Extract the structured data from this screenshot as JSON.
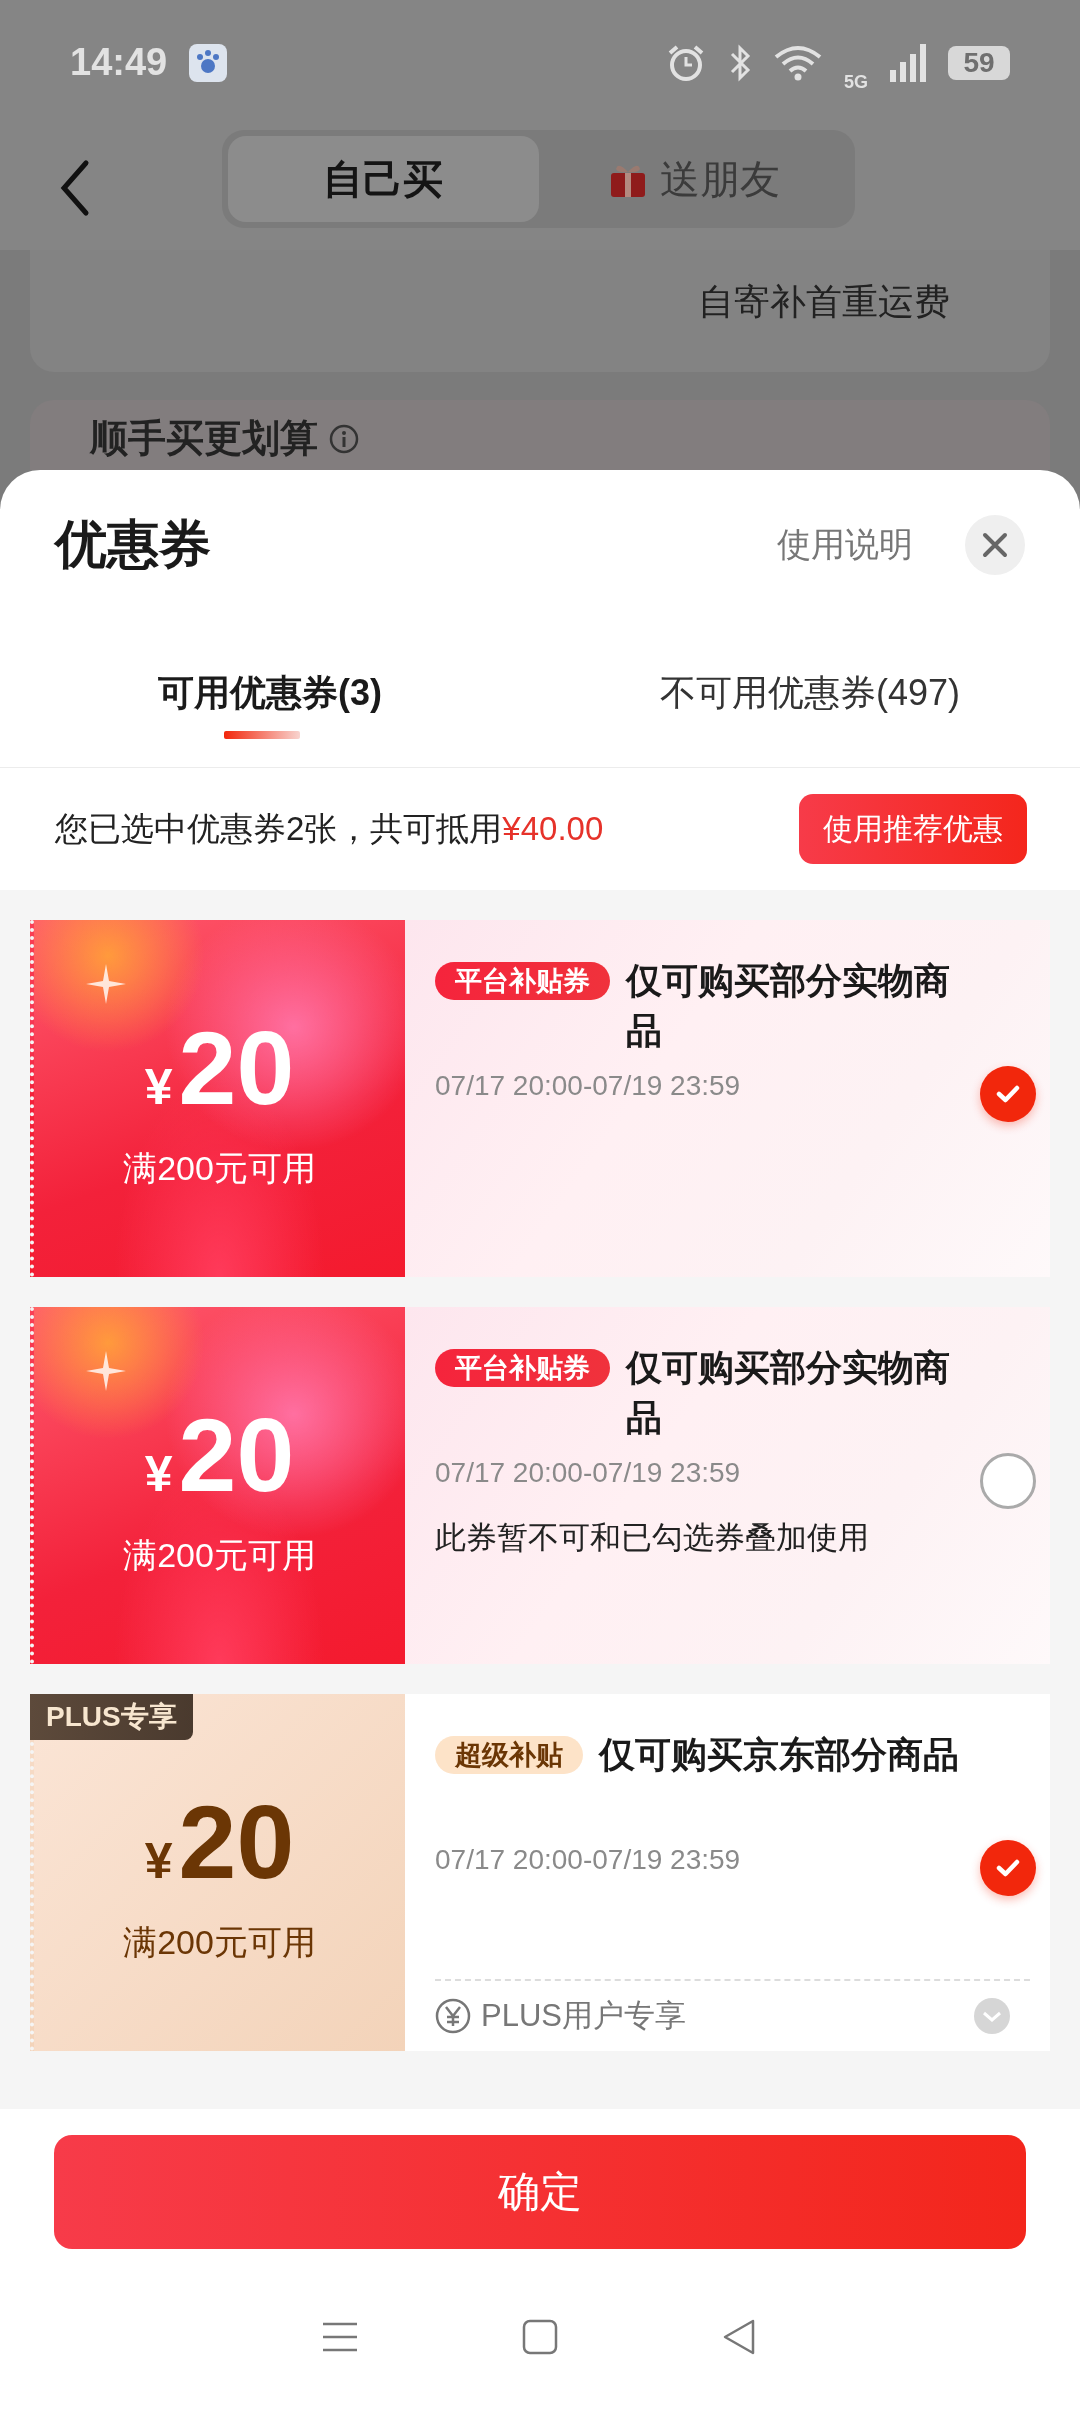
{
  "status_bar": {
    "time": "14:49",
    "network": "5G",
    "battery": "59"
  },
  "header": {
    "segments": [
      {
        "label": "自己买",
        "selected": true,
        "kind": "plain"
      },
      {
        "label": "送朋友",
        "selected": false,
        "kind": "gift"
      }
    ]
  },
  "background_cards": [
    {
      "text": "自寄补首重运费"
    },
    {
      "title": "顺手买更划算"
    }
  ],
  "sheet": {
    "title": "优惠券",
    "help_link": "使用说明",
    "tabs": [
      {
        "label": "可用优惠券(3)",
        "selected": true
      },
      {
        "label": "不可用优惠券(497)",
        "selected": false
      }
    ],
    "summary": {
      "text": "您已选中优惠券2张，共可抵用",
      "amount": "¥40.00",
      "button": "使用推荐优惠"
    },
    "coupons": [
      {
        "kind": "red",
        "currency": "¥",
        "amount": "20",
        "condition": "满200元可用",
        "tag": "平台补贴券",
        "title": "仅可购买部分实物商品",
        "validity": "07/17 20:00-07/19 23:59",
        "checked": true
      },
      {
        "kind": "red",
        "currency": "¥",
        "amount": "20",
        "condition": "满200元可用",
        "tag": "平台补贴券",
        "title": "仅可购买部分实物商品",
        "validity": "07/17 20:00-07/19 23:59",
        "note": "此券暂不可和已勾选券叠加使用",
        "checked": false
      },
      {
        "kind": "plus",
        "badge": "PLUS专享",
        "currency": "¥",
        "amount": "20",
        "condition": "满200元可用",
        "tag": "超级补贴",
        "title": "仅可购买京东部分商品",
        "validity": "07/17 20:00-07/19 23:59",
        "checked": true,
        "footer": "PLUS用户专享"
      }
    ],
    "confirm_button": "确定"
  }
}
